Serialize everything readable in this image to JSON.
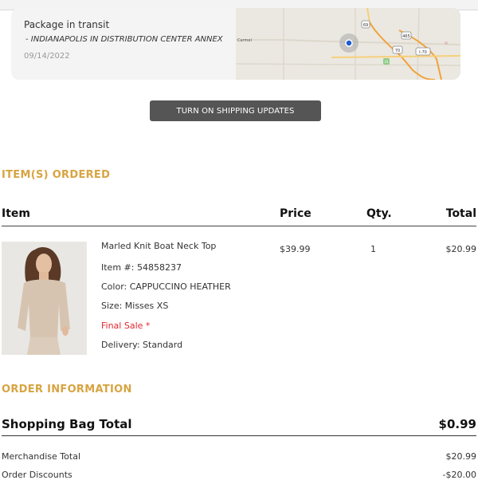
{
  "tracking": {
    "status": "Package in transit",
    "location": "- INDIANAPOLIS IN DISTRIBUTION CENTER ANNEX",
    "date": "09/14/2022",
    "map_labels": [
      "Carmel",
      "69",
      "465",
      "70",
      "31",
      "I-70"
    ]
  },
  "shipping_button": "TURN ON SHIPPING UPDATES",
  "items_section": {
    "title": "ITEM(S) ORDERED",
    "columns": {
      "item": "Item",
      "price": "Price",
      "qty": "Qty.",
      "total": "Total"
    },
    "product": {
      "name": "Marled Knit Boat Neck Top",
      "item_number": "Item #: 54858237",
      "color": "Color: CAPPUCCINO HEATHER",
      "size": "Size: Misses XS",
      "final_sale": "Final Sale *",
      "delivery": "Delivery: Standard",
      "price": "$39.99",
      "qty": "1",
      "total": "$20.99"
    }
  },
  "order_info": {
    "title": "ORDER INFORMATION",
    "bag_total_label": "Shopping Bag Total",
    "bag_total_value": "$0.99",
    "rows": [
      {
        "label": "Merchandise Total",
        "value": "$20.99"
      },
      {
        "label": "Order Discounts",
        "value": "-$20.00"
      }
    ]
  },
  "colors": {
    "accent": "#d8a441",
    "final_sale": "#e0282f",
    "button": "#555555"
  }
}
